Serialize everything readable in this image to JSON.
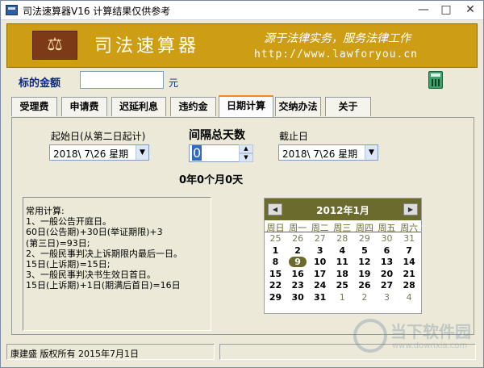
{
  "window": {
    "title": "司法速算器V16  计算结果仅供参考",
    "minimize": "—",
    "maximize": "□",
    "close": "✕"
  },
  "banner": {
    "logo_glyph": "⚖",
    "brand": "司法速算器",
    "slogan": "源于法律实务，服务法律工作",
    "url": "http://www.lawforyou.cn"
  },
  "amount": {
    "label": "标的金额",
    "value": "",
    "unit": "元",
    "calculator_icon": "calculator-icon"
  },
  "tabs": [
    {
      "label": "受理费",
      "active": false
    },
    {
      "label": "申请费",
      "active": false
    },
    {
      "label": "迟延利息",
      "active": false
    },
    {
      "label": "违约金",
      "active": false
    },
    {
      "label": "日期计算",
      "active": true
    },
    {
      "label": "交纳办法",
      "active": false
    },
    {
      "label": "关于",
      "active": false
    }
  ],
  "date_calc": {
    "start_label": "起始日(从第二日起计)",
    "start_date": "2018\\ 7\\26 星期",
    "end_label": "截止日",
    "end_date": "2018\\ 7\\26 星期",
    "interval_label": "间隔总天数",
    "interval_value": "0",
    "interval_result": "0年0个月0天"
  },
  "notes": [
    "常用计算:",
    "1、一般公告开庭日。",
    " 60日(公告期)+30日(举证期限)+3",
    "(第三日)=93日;",
    "2、一般民事判决上诉期限内最后一日。",
    " 15日(上诉期)=15日;",
    "3、一般民事判决书生效日首日。",
    " 15日(上诉期)+1日(期满后首日)=16日"
  ],
  "calendar": {
    "title": "2012年1月",
    "prev": "◀",
    "next": "▶",
    "weekdays": [
      "周日",
      "周一",
      "周二",
      "周三",
      "周四",
      "周五",
      "周六"
    ],
    "weeks": [
      [
        "25",
        "26",
        "27",
        "28",
        "29",
        "30",
        "31"
      ],
      [
        "1",
        "2",
        "3",
        "4",
        "5",
        "6",
        "7"
      ],
      [
        "8",
        "9",
        "10",
        "11",
        "12",
        "13",
        "14"
      ],
      [
        "15",
        "16",
        "17",
        "18",
        "19",
        "20",
        "21"
      ],
      [
        "22",
        "23",
        "24",
        "25",
        "26",
        "27",
        "28"
      ],
      [
        "29",
        "30",
        "31",
        "1",
        "2",
        "3",
        "4"
      ]
    ],
    "today": "9"
  },
  "status": {
    "left": "康建盛 版权所有  2015年7月1日",
    "right": ""
  },
  "watermark": {
    "title": "当下软件园",
    "url": "www.downxia.com"
  }
}
